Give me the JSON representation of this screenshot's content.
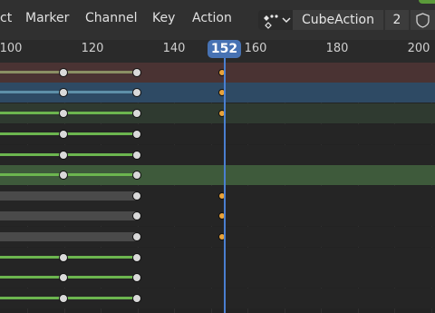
{
  "menu": {
    "items": [
      {
        "id": "select",
        "label": "ct"
      },
      {
        "id": "marker",
        "label": "Marker"
      },
      {
        "id": "channel",
        "label": "Channel"
      },
      {
        "id": "key",
        "label": "Key"
      },
      {
        "id": "action",
        "label": "Action"
      }
    ]
  },
  "action": {
    "mode_icon": "action-mode-icon",
    "name": "CubeAction",
    "users": "2",
    "fake_user_icon": "shield-icon"
  },
  "timeline": {
    "current_frame": "152",
    "ticks": [
      {
        "frame": 100,
        "label": "100"
      },
      {
        "frame": 120,
        "label": "120"
      },
      {
        "frame": 140,
        "label": "140"
      },
      {
        "frame": 160,
        "label": "160"
      },
      {
        "frame": 180,
        "label": "180"
      },
      {
        "frame": 200,
        "label": "200"
      }
    ]
  },
  "channels": [
    {
      "type": "object",
      "keys": [
        [
          113,
          "bd"
        ],
        [
          131,
          "bd"
        ],
        [
          152,
          "sel"
        ]
      ],
      "hold": "olive"
    },
    {
      "type": "action",
      "keys": [
        [
          113,
          "bd"
        ],
        [
          131,
          "bd"
        ],
        [
          152,
          "sel"
        ]
      ],
      "hold": "teal"
    },
    {
      "type": "group",
      "keys": [
        [
          113,
          "bd"
        ],
        [
          131,
          "bd"
        ],
        [
          152,
          "sel"
        ]
      ],
      "hold": "green"
    },
    {
      "type": "fcurve",
      "keys": [
        [
          113,
          "bd"
        ],
        [
          131,
          "bd"
        ]
      ],
      "hold": "green"
    },
    {
      "type": "fcurve",
      "keys": [
        [
          113,
          "bd"
        ],
        [
          131,
          "bd"
        ]
      ],
      "hold": "green"
    },
    {
      "type": "group",
      "keys": [
        [
          113,
          "bd"
        ],
        [
          131,
          "bd"
        ]
      ],
      "hold": "green"
    },
    {
      "type": "fcurve",
      "keys": [
        [
          131,
          "bd"
        ],
        [
          152,
          "sel"
        ]
      ],
      "hold": "grey"
    },
    {
      "type": "fcurve",
      "keys": [
        [
          131,
          "bd"
        ],
        [
          152,
          "sel"
        ]
      ],
      "hold": "grey"
    },
    {
      "type": "fcurve",
      "keys": [
        [
          131,
          "bd"
        ],
        [
          152,
          "sel"
        ]
      ],
      "hold": "grey"
    },
    {
      "type": "fcurve",
      "keys": [
        [
          113,
          "bd"
        ],
        [
          131,
          "bd"
        ]
      ],
      "hold": "green"
    },
    {
      "type": "fcurve",
      "keys": [
        [
          113,
          "bd"
        ],
        [
          131,
          "bd"
        ]
      ],
      "hold": "green"
    },
    {
      "type": "fcurve",
      "keys": [
        [
          113,
          "bd"
        ],
        [
          131,
          "bd"
        ]
      ],
      "hold": "green"
    }
  ],
  "colors": {
    "accent": "#4772b3",
    "key_unselected": "#d9d9d9",
    "key_selected": "#e8a23a",
    "hold_green": "#6cb54f",
    "hold_grey": "#4a4a4a"
  }
}
